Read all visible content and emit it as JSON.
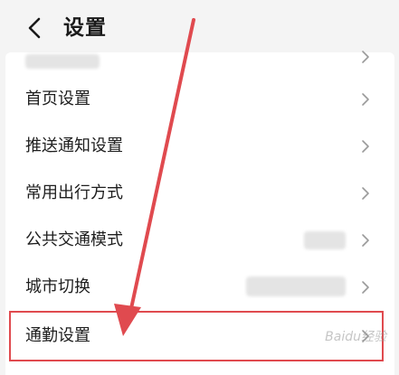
{
  "header": {
    "title": "设置",
    "back_icon": "chevron-left-icon"
  },
  "settings_items": [
    {
      "label": "首页设置"
    },
    {
      "label": "推送通知设置"
    },
    {
      "label": "常用出行方式"
    },
    {
      "label": "公共交通模式"
    },
    {
      "label": "城市切换"
    },
    {
      "label": "通勤设置"
    }
  ],
  "watermark": "Baidu经验",
  "colors": {
    "background": "#f4f4f4",
    "card": "#ffffff",
    "annotation_red": "#e04a4f",
    "chevron": "#9a9a9a"
  }
}
